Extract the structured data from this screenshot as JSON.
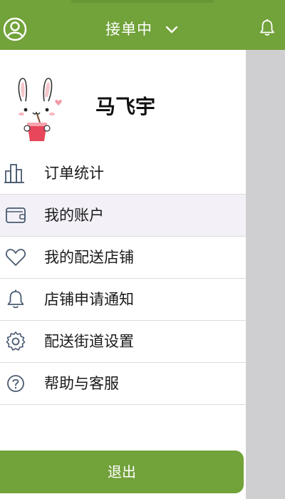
{
  "header": {
    "status_title": "接单中",
    "icons": {
      "user": "user-circle-icon",
      "chevron": "chevron-down-icon",
      "bell": "bell-icon"
    }
  },
  "profile": {
    "name": "马飞宇"
  },
  "menu": {
    "items": [
      {
        "label": "订单统计",
        "icon": "bar-chart-icon"
      },
      {
        "label": "我的账户",
        "icon": "wallet-icon"
      },
      {
        "label": "我的配送店铺",
        "icon": "heart-icon"
      },
      {
        "label": "店铺申请通知",
        "icon": "bell-icon"
      },
      {
        "label": "配送街道设置",
        "icon": "gear-icon"
      },
      {
        "label": "帮助与客服",
        "icon": "question-circle-icon"
      }
    ]
  },
  "logout": {
    "label": "退出"
  },
  "colors": {
    "brand": "#72a23a",
    "overlay": "#cfcfd1",
    "active_row": "#f3f1f7"
  }
}
